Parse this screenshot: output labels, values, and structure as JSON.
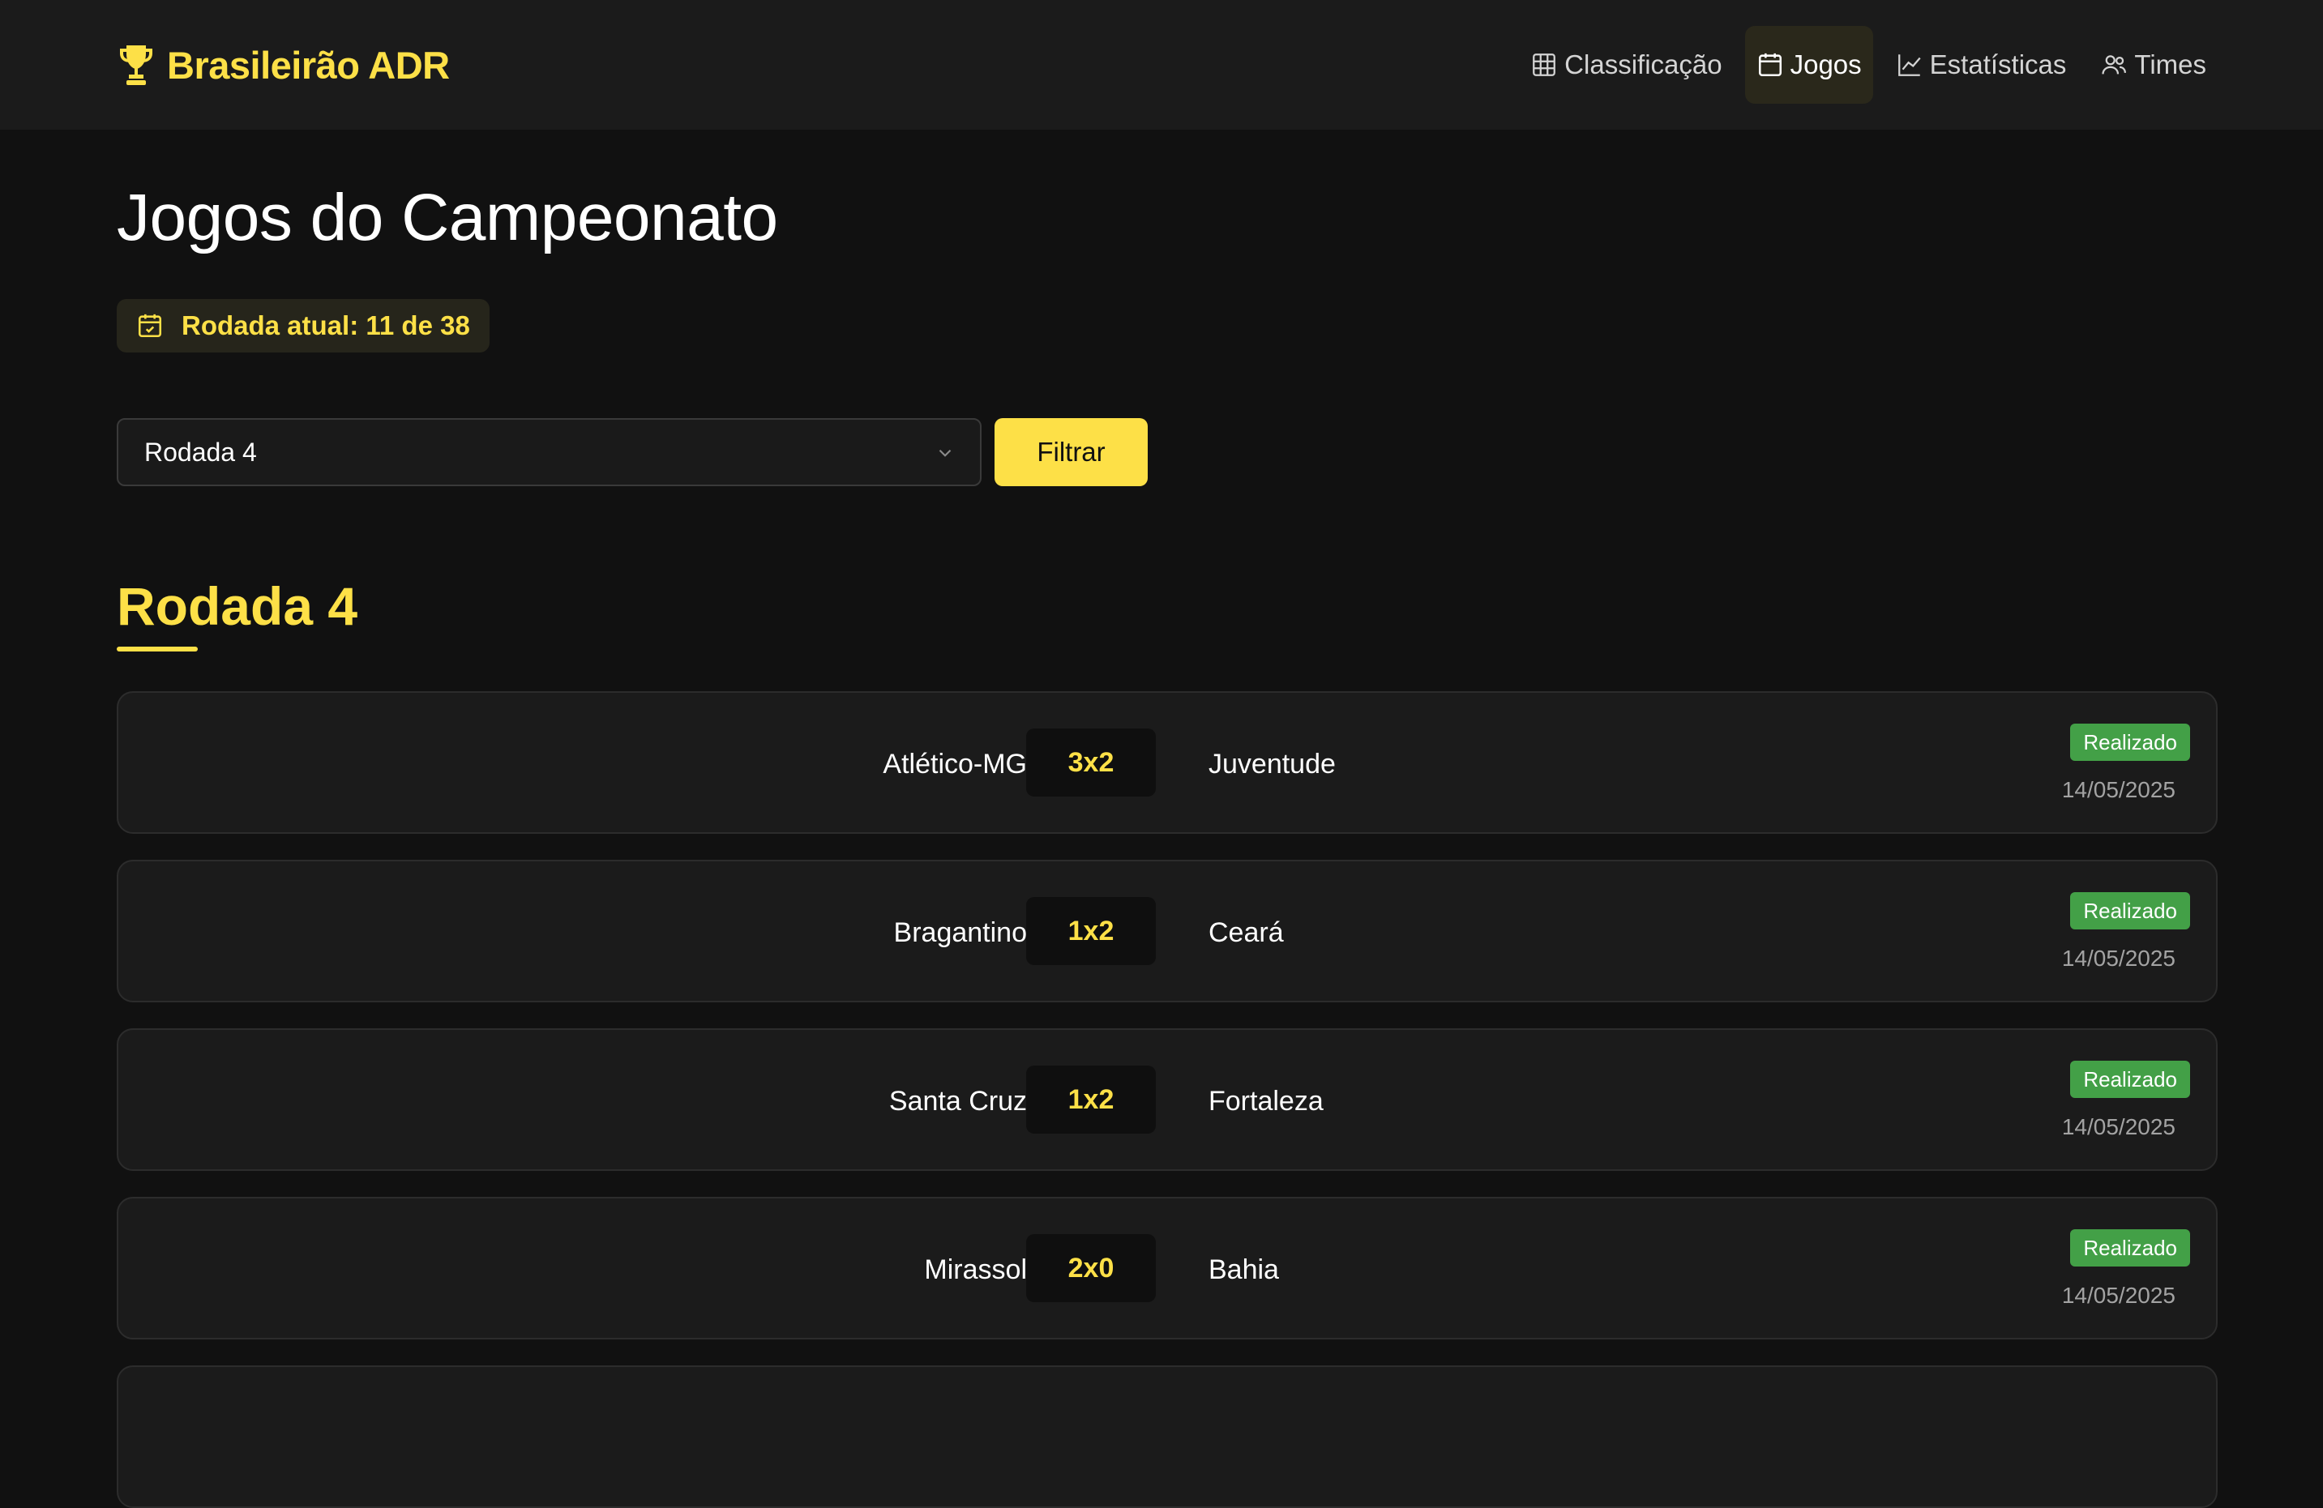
{
  "app": {
    "brand": "Brasileirão ADR",
    "brand_icon": "trophy-icon",
    "accent_color": "#fde047",
    "status_color": "#43a047"
  },
  "nav": {
    "items": [
      {
        "label": "Classificação",
        "icon": "table-icon",
        "active": false
      },
      {
        "label": "Jogos",
        "icon": "calendar-icon",
        "active": true
      },
      {
        "label": "Estatísticas",
        "icon": "chart-line-icon",
        "active": false
      },
      {
        "label": "Times",
        "icon": "users-icon",
        "active": false
      }
    ]
  },
  "page": {
    "title": "Jogos do Campeonato",
    "current_round": "Rodada atual: 11 de 38"
  },
  "filter": {
    "selected": "Rodada 4",
    "button": "Filtrar"
  },
  "section": {
    "title": "Rodada 4"
  },
  "matches": [
    {
      "home": "Atlético-MG",
      "score": "3x2",
      "away": "Juventude",
      "status": "Realizado",
      "date": "14/05/2025"
    },
    {
      "home": "Bragantino",
      "score": "1x2",
      "away": "Ceará",
      "status": "Realizado",
      "date": "14/05/2025"
    },
    {
      "home": "Santa Cruz",
      "score": "1x2",
      "away": "Fortaleza",
      "status": "Realizado",
      "date": "14/05/2025"
    },
    {
      "home": "Mirassol",
      "score": "2x0",
      "away": "Bahia",
      "status": "Realizado",
      "date": "14/05/2025"
    }
  ]
}
